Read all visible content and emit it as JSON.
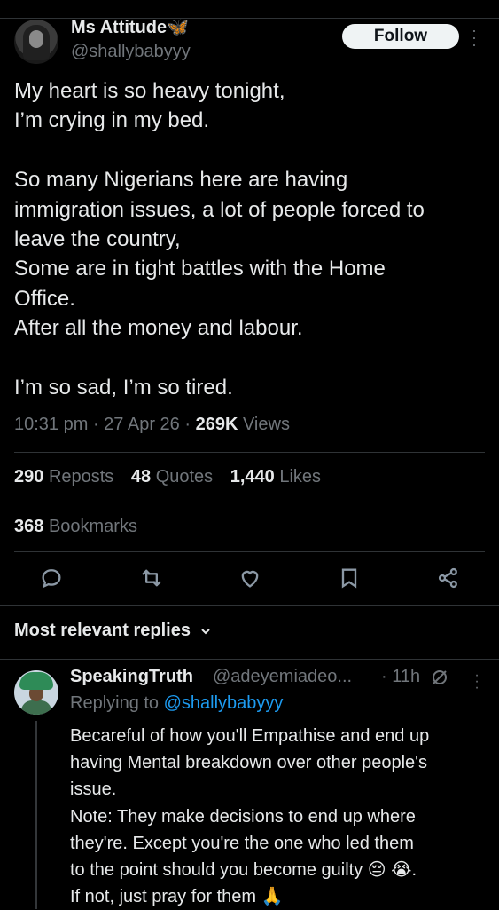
{
  "tweet": {
    "author_name": "Ms Attitude🦋",
    "author_handle": "@shallybabyyy",
    "follow_label": "Follow",
    "text_lines": [
      "My heart is so heavy tonight,",
      "I’m crying in my bed.",
      "",
      "So many Nigerians here are having",
      "immigration issues, a lot of people forced to",
      "leave the country,",
      "Some are in tight battles with the Home",
      "Office.",
      "After all the money and labour.",
      "",
      "I’m so sad, I’m so tired."
    ],
    "time": "10:31 pm",
    "date": "27 Apr 26",
    "views_count": "269K",
    "views_label": "Views"
  },
  "stats": {
    "reposts_count": "290",
    "reposts_label": "Reposts",
    "quotes_count": "48",
    "quotes_label": "Quotes",
    "likes_count": "1,440",
    "likes_label": "Likes",
    "bookmarks_count": "368",
    "bookmarks_label": "Bookmarks"
  },
  "actions": [
    "reply-icon",
    "repost-icon",
    "like-icon",
    "bookmark-icon",
    "share-icon"
  ],
  "replies_header": "Most relevant replies",
  "reply": {
    "author_name": "SpeakingTruth",
    "author_handle": "@adeyemiadeo...",
    "time": "· 11h",
    "replying_prefix": "Replying to",
    "replying_to": "@shallybabyyy",
    "text_lines": [
      "Becareful of how you'll Empathise and end up",
      "having Mental breakdown over other people's",
      "issue.",
      "Note: They make decisions to end up where",
      "they're. Except you're the one who led them",
      "to the point should you become guilty 😔 😭.",
      "If not, just pray for them 🙏"
    ]
  },
  "colors": {
    "background": "#000000",
    "text": "#e7e9ea",
    "muted": "#71767b",
    "link": "#1d9bf0",
    "divider": "#2f3336"
  }
}
